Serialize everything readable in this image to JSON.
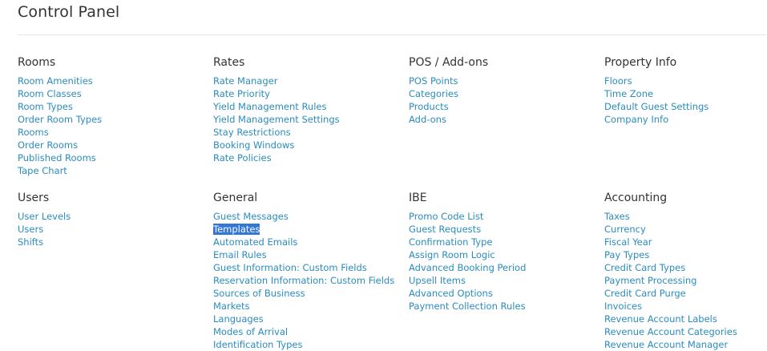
{
  "page_title": "Control Panel",
  "colors": {
    "link": "#2a8cbd",
    "heading": "#333333",
    "selection_bg": "#3276d6",
    "selection_text": "#ffffff"
  },
  "sections": {
    "rooms": {
      "title": "Rooms",
      "links": [
        "Room Amenities",
        "Room Classes",
        "Room Types",
        "Order Room Types",
        "Rooms",
        "Order Rooms",
        "Published Rooms",
        "Tape Chart"
      ]
    },
    "rates": {
      "title": "Rates",
      "links": [
        "Rate Manager",
        "Rate Priority",
        "Yield Management Rules",
        "Yield Management Settings",
        "Stay Restrictions",
        "Booking Windows",
        "Rate Policies"
      ]
    },
    "pos": {
      "title": "POS / Add-ons",
      "links": [
        "POS Points",
        "Categories",
        "Products",
        "Add-ons"
      ]
    },
    "property": {
      "title": "Property Info",
      "links": [
        "Floors",
        "Time Zone",
        "Default Guest Settings",
        "Company Info"
      ]
    },
    "users": {
      "title": "Users",
      "links": [
        "User Levels",
        "Users",
        "Shifts"
      ]
    },
    "general": {
      "title": "General",
      "links": [
        "Guest Messages",
        "Templates",
        "Automated Emails",
        "Email Rules",
        "Guest Information: Custom Fields",
        "Reservation Information: Custom Fields",
        "Sources of Business",
        "Markets",
        "Languages",
        "Modes of Arrival",
        "Identification Types"
      ],
      "selected_link": "Templates"
    },
    "ibe": {
      "title": "IBE",
      "links": [
        "Promo Code List",
        "Guest Requests",
        "Confirmation Type",
        "Assign Room Logic",
        "Advanced Booking Period",
        "Upsell Items",
        "Advanced Options",
        "Payment Collection Rules"
      ]
    },
    "accounting": {
      "title": "Accounting",
      "links": [
        "Taxes",
        "Currency",
        "Fiscal Year",
        "Pay Types",
        "Credit Card Types",
        "Payment Processing",
        "Credit Card Purge",
        "Invoices",
        "Revenue Account Labels",
        "Revenue Account Categories",
        "Revenue Account Manager"
      ]
    }
  }
}
